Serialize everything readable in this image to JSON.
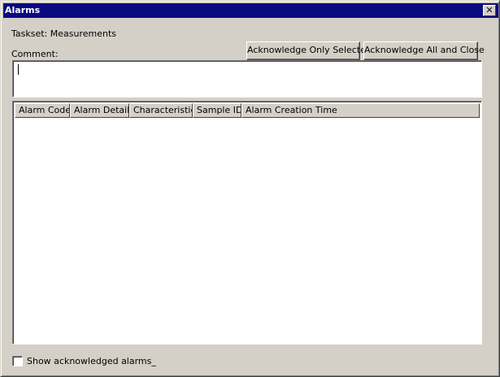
{
  "window": {
    "title": "Alarms",
    "close_label": "✕"
  },
  "taskset_label": "Taskset: Measurements",
  "comment": {
    "label": "Comment:",
    "value": ""
  },
  "buttons": {
    "ack_selected": "Acknowledge Only Selected",
    "ack_all": "Acknowledge All and Close"
  },
  "table": {
    "columns": [
      "Alarm Code",
      "Alarm Details",
      "Characteristic",
      "Sample ID",
      "Alarm Creation Time"
    ],
    "rows": []
  },
  "show_acknowledged": {
    "label": "Show acknowledged alarms_",
    "checked": false
  }
}
